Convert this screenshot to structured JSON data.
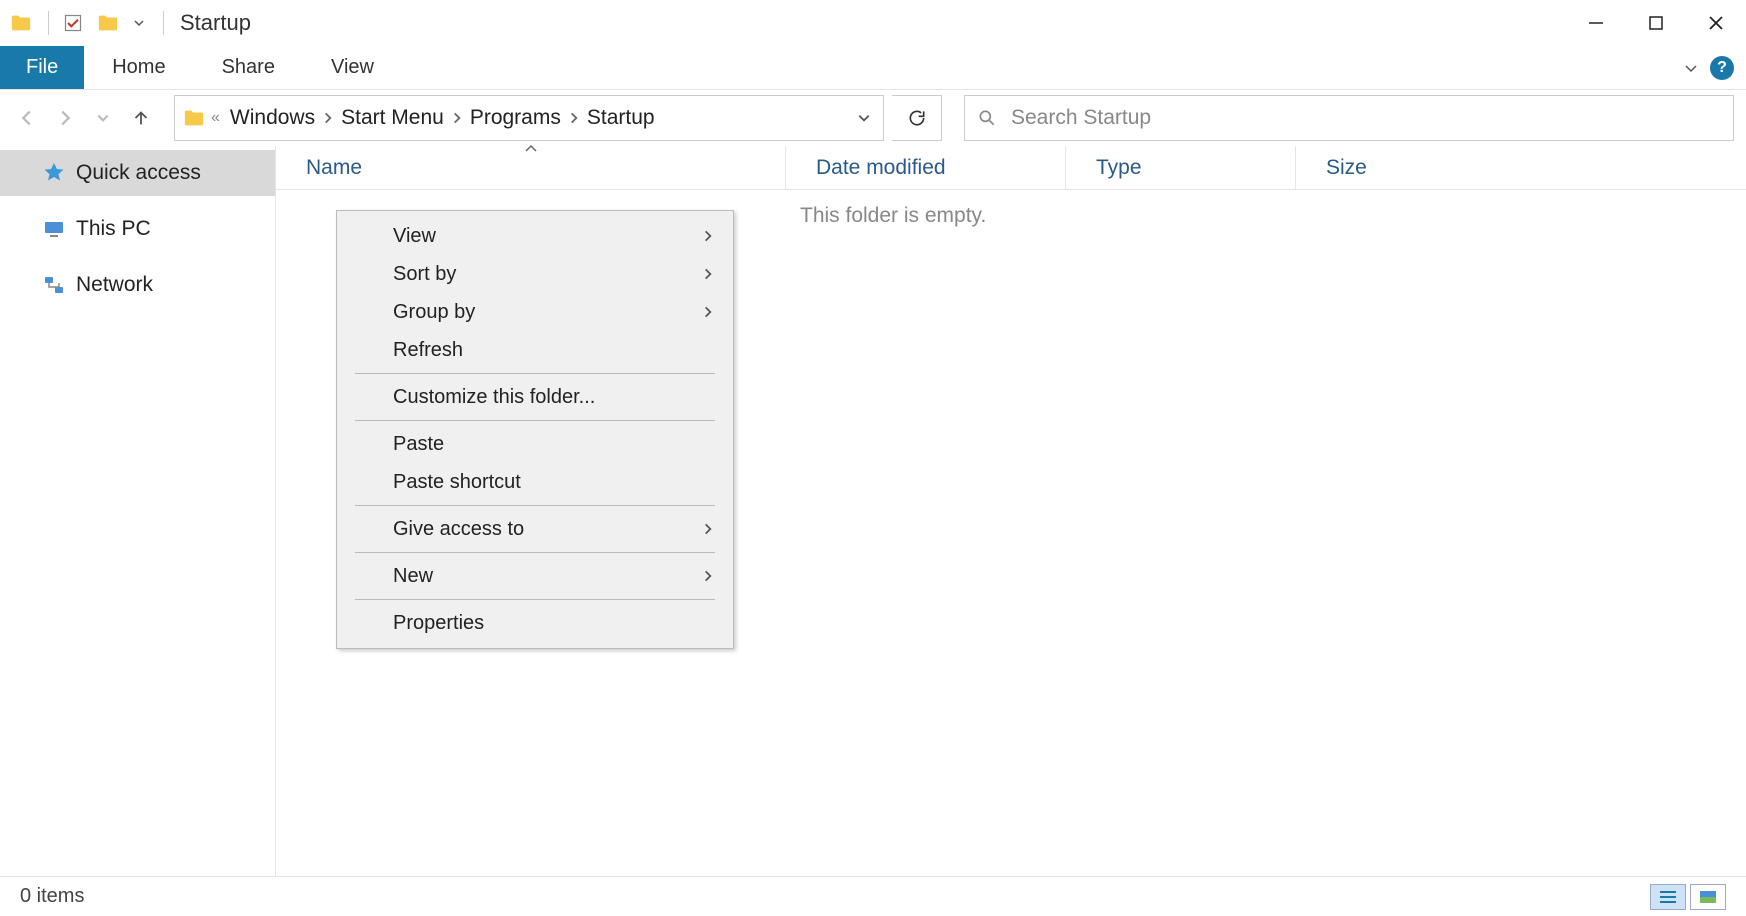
{
  "window": {
    "title": "Startup"
  },
  "ribbon": {
    "file": "File",
    "tabs": [
      "Home",
      "Share",
      "View"
    ]
  },
  "breadcrumb": {
    "segments": [
      "Windows",
      "Start Menu",
      "Programs",
      "Startup"
    ]
  },
  "search": {
    "placeholder": "Search Startup"
  },
  "sidebar": {
    "items": [
      {
        "label": "Quick access",
        "icon": "star"
      },
      {
        "label": "This PC",
        "icon": "pc"
      },
      {
        "label": "Network",
        "icon": "network"
      }
    ]
  },
  "columns": {
    "name": "Name",
    "date": "Date modified",
    "type": "Type",
    "size": "Size"
  },
  "content": {
    "empty_message": "This folder is empty."
  },
  "context_menu": {
    "items": [
      {
        "label": "View",
        "submenu": true
      },
      {
        "label": "Sort by",
        "submenu": true
      },
      {
        "label": "Group by",
        "submenu": true
      },
      {
        "label": "Refresh",
        "submenu": false
      },
      {
        "sep": true
      },
      {
        "label": "Customize this folder...",
        "submenu": false
      },
      {
        "sep": true
      },
      {
        "label": "Paste",
        "submenu": false
      },
      {
        "label": "Paste shortcut",
        "submenu": false
      },
      {
        "sep": true
      },
      {
        "label": "Give access to",
        "submenu": true
      },
      {
        "sep": true
      },
      {
        "label": "New",
        "submenu": true
      },
      {
        "sep": true
      },
      {
        "label": "Properties",
        "submenu": false
      }
    ]
  },
  "statusbar": {
    "text": "0 items"
  }
}
